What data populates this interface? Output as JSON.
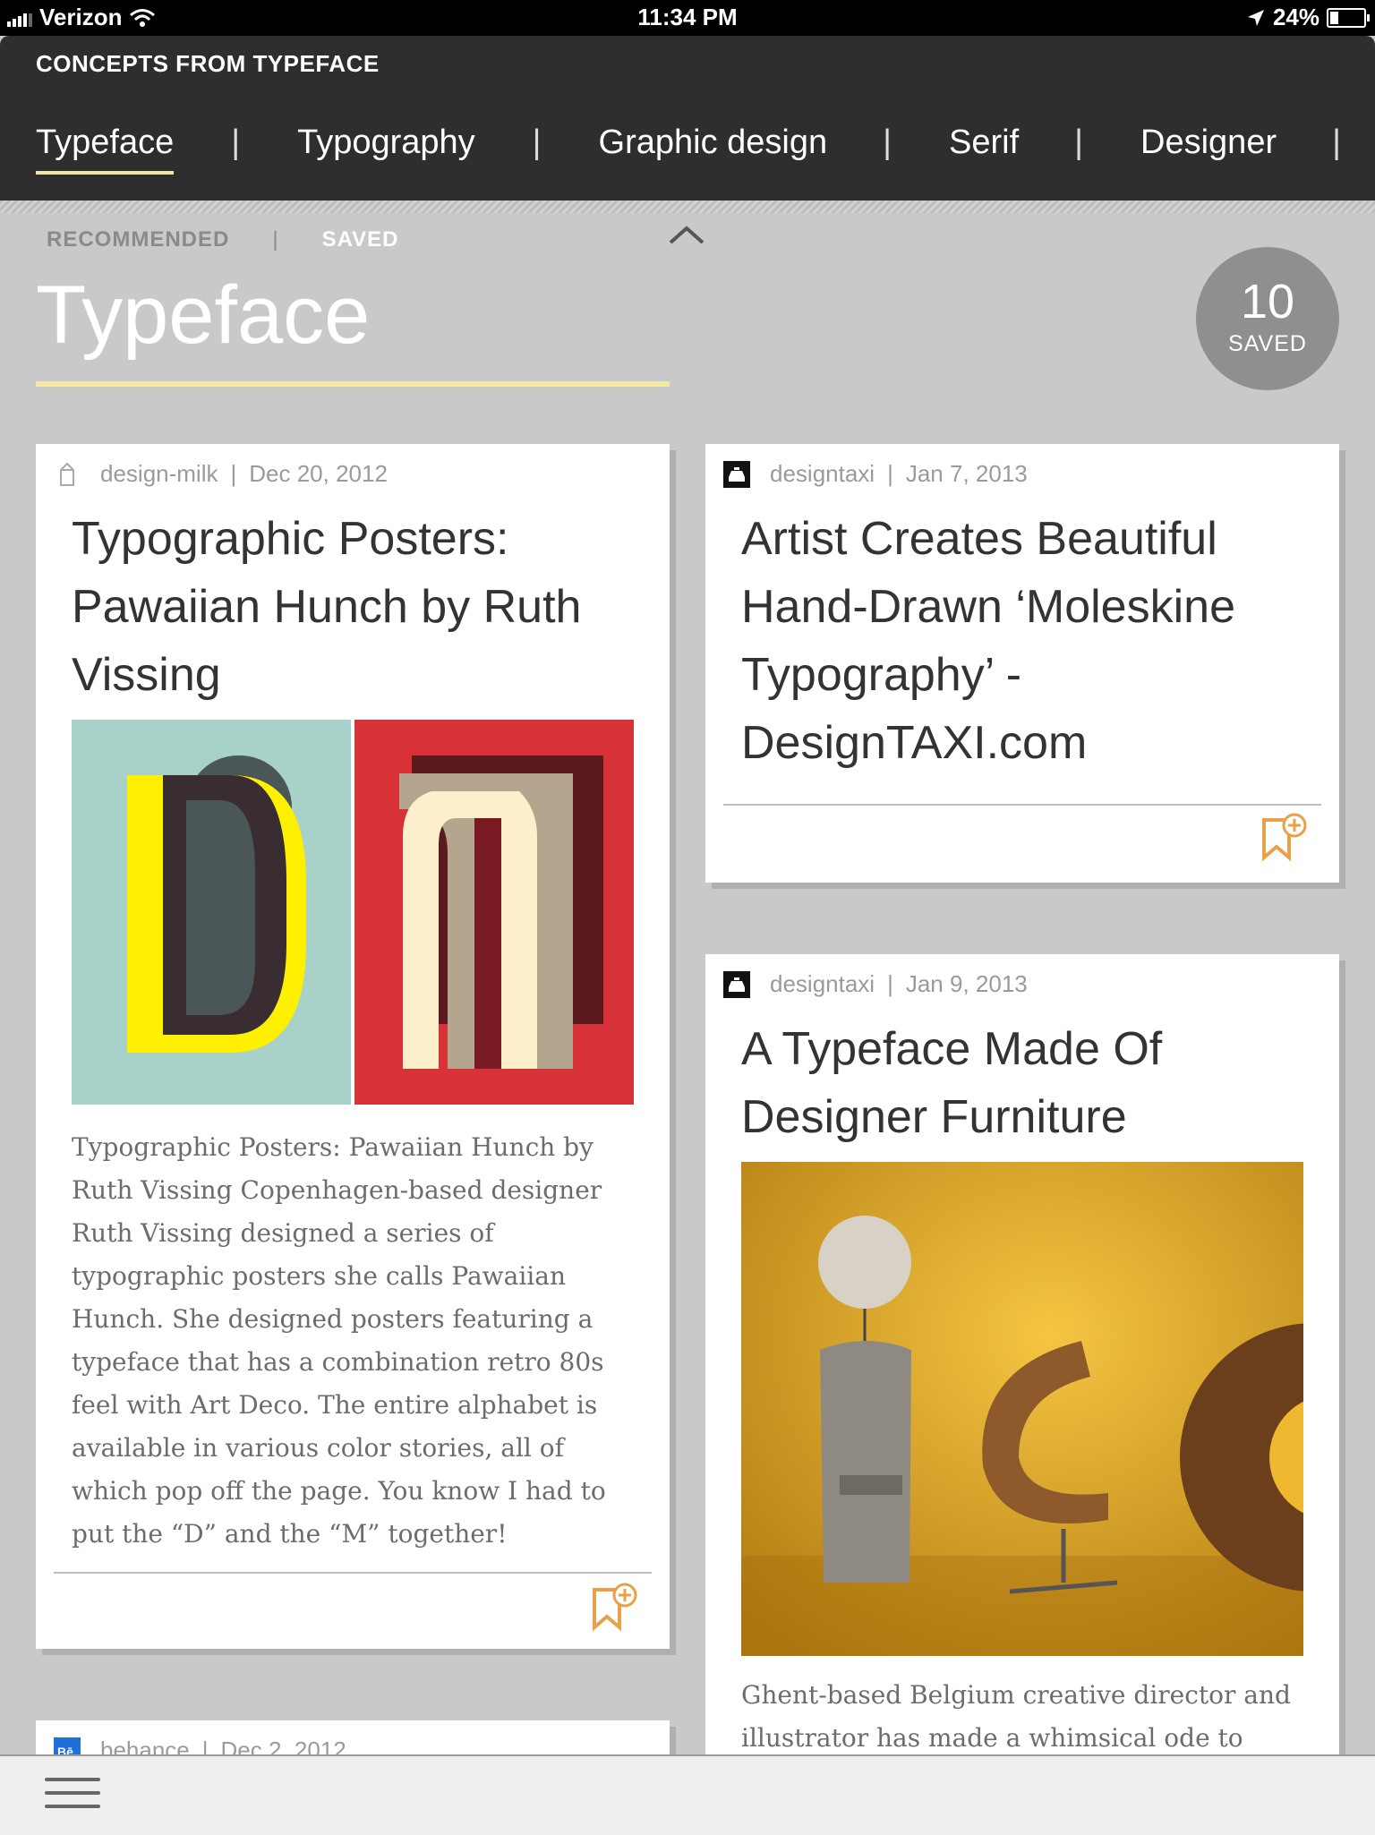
{
  "status_bar": {
    "carrier": "Verizon",
    "time": "11:34 PM",
    "battery": "24%",
    "battery_level": 0.24
  },
  "header": {
    "app_title": "CONCEPTS FROM TYPEFACE",
    "topics": [
      {
        "label": "Typeface",
        "active": true
      },
      {
        "label": "Typography",
        "active": false
      },
      {
        "label": "Graphic design",
        "active": false
      },
      {
        "label": "Serif",
        "active": false
      },
      {
        "label": "Designer",
        "active": false
      }
    ],
    "separator": "|"
  },
  "section": {
    "subtab_recommended": "RECOMMENDED",
    "subtab_separator": "|",
    "subtab_saved": "SAVED",
    "title": "Typeface",
    "saved_count": "10",
    "saved_label": "SAVED"
  },
  "cards": [
    {
      "source": "design-milk",
      "date": "Dec 20, 2012",
      "title": "Typographic Posters: Pawaiian Hunch by Ruth Vissing",
      "image": "Posters of letters D and M",
      "description": "Typographic Posters: Pawaiian Hunch by Ruth Vissing Copenhagen-based designer Ruth Vissing designed a series of typographic posters she calls Pawaiian Hunch. She designed posters featuring a typeface that has a combination retro 80s feel with Art Deco. The entire alphabet is available in various color stories, all of which pop off the page. You know I had to put the “D” and the “M” together!"
    },
    {
      "source": "designtaxi",
      "date": "Jan 7, 2013",
      "title": "Artist Creates Beautiful Hand-Drawn ‘Moleskine Typography’ - DesignTAXI.com"
    },
    {
      "source": "designtaxi",
      "date": "Jan 9, 2013",
      "title": "A Typeface Made Of Designer Furniture",
      "image": "Furniture shaped like letters on yellow background",
      "description": "Ghent-based Belgium creative director and illustrator has made a whimsical ode to"
    },
    {
      "source": "behance",
      "date": "Dec 2, 2012"
    }
  ],
  "icons": {
    "bookmark": "bookmark-add-icon",
    "menu": "hamburger-menu-icon",
    "collapse": "chevron-up-icon",
    "designtaxi": "taxi-icon",
    "design_milk": "milk-carton-icon",
    "behance": "behance-icon"
  },
  "colors": {
    "accent": "#e8a04a",
    "header_bg": "#2e2e2e",
    "page_bg": "#c9c9c9",
    "underline": "#f3e7a6"
  }
}
